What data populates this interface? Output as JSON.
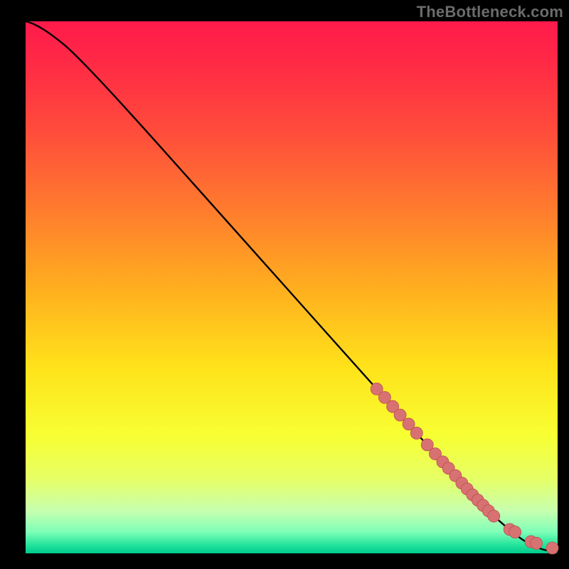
{
  "watermark": "TheBottleneck.com",
  "colors": {
    "marker_fill": "#d87272",
    "marker_stroke": "#bb4f4f",
    "curve": "#000000",
    "frame": "#000000"
  },
  "chart_data": {
    "type": "line",
    "title": "",
    "xlabel": "",
    "ylabel": "",
    "xlim": [
      0,
      100
    ],
    "ylim": [
      0,
      100
    ],
    "grid": false,
    "legend": false,
    "background_gradient_stops": [
      {
        "offset": 0.0,
        "color": "#ff1a4b"
      },
      {
        "offset": 0.08,
        "color": "#ff2a45"
      },
      {
        "offset": 0.2,
        "color": "#ff4a3c"
      },
      {
        "offset": 0.35,
        "color": "#ff7a2e"
      },
      {
        "offset": 0.5,
        "color": "#ffae1f"
      },
      {
        "offset": 0.65,
        "color": "#ffe21a"
      },
      {
        "offset": 0.78,
        "color": "#f7ff33"
      },
      {
        "offset": 0.86,
        "color": "#e6ff66"
      },
      {
        "offset": 0.92,
        "color": "#c7ffb0"
      },
      {
        "offset": 0.96,
        "color": "#7dffb7"
      },
      {
        "offset": 0.985,
        "color": "#21e39b"
      },
      {
        "offset": 1.0,
        "color": "#00c98c"
      }
    ],
    "series": [
      {
        "name": "curve",
        "type": "line",
        "x": [
          0.0,
          1.5,
          3.5,
          6.0,
          9.0,
          15.0,
          25.0,
          40.0,
          55.0,
          66.0,
          75.0,
          82.0,
          87.0,
          91.0,
          94.0,
          97.0,
          100.0
        ],
        "y": [
          100.0,
          99.5,
          98.4,
          96.6,
          94.0,
          87.8,
          76.8,
          60.0,
          43.2,
          30.9,
          20.9,
          13.2,
          8.0,
          4.4,
          2.2,
          0.8,
          0.2
        ]
      },
      {
        "name": "markers",
        "type": "scatter",
        "x": [
          66.0,
          67.5,
          69.0,
          70.4,
          72.0,
          73.5,
          75.5,
          77.0,
          78.4,
          79.5,
          80.8,
          82.0,
          83.0,
          84.0,
          85.0,
          86.0,
          87.0,
          88.0,
          91.0,
          92.0,
          95.0,
          96.0,
          99.0
        ],
        "y": [
          30.9,
          29.3,
          27.6,
          26.0,
          24.3,
          22.6,
          20.4,
          18.7,
          17.2,
          16.0,
          14.6,
          13.2,
          12.1,
          11.0,
          10.0,
          9.0,
          8.0,
          7.0,
          4.5,
          4.0,
          2.2,
          1.9,
          1.0
        ]
      }
    ]
  }
}
